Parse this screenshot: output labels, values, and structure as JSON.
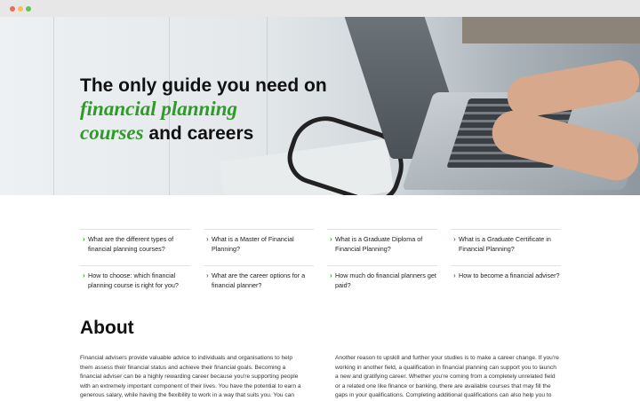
{
  "hero": {
    "title_line1": "The only guide you need on",
    "title_accent1": "financial planning",
    "title_accent2": "courses",
    "title_end": " and careers"
  },
  "quick_links": [
    {
      "label": "What are the different types of financial planning courses?"
    },
    {
      "label": "What is a Master of Financial Planning?"
    },
    {
      "label": "What is a Graduate Diploma of Financial Planning?"
    },
    {
      "label": "What is a Graduate Certificate in Financial Planning?"
    },
    {
      "label": "How to choose: which financial planning course is right for you?"
    },
    {
      "label": "What are the career options for  a financial planner?"
    },
    {
      "label": "How much do financial  planners get paid?"
    },
    {
      "label": "How to become a financial adviser?"
    }
  ],
  "about": {
    "heading": "About",
    "left_text": "Financial advisers provide valuable advice to individuals and organisations to help them assess their financial status and achieve their financial goals. Becoming a financial adviser can be a highly rewarding career because you're supporting people with an extremely important component of their lives. You have the potential to earn a generous salary, while having the flexibility to work in a way that suits you. You can",
    "right_text": "Another reason to upskill and further your studies is to make a career change. If you're working in another field, a qualification in financial planning can support you to launch a new and gratifying career. Whether you're coming from a completely unrelated field or a related one like finance or banking, there are available courses that may fill the gaps in your qualifications. Completing additional qualifications can also help you to meet"
  },
  "colors": {
    "accent": "#2f9a2a",
    "text": "#1b1b1b"
  },
  "icons": {
    "link_chevron": "›"
  }
}
